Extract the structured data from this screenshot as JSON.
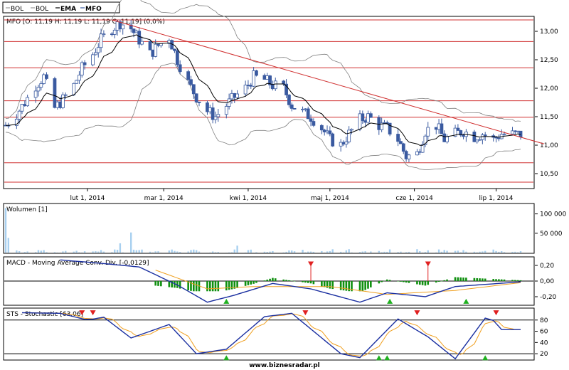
{
  "legend": {
    "items": [
      {
        "label": "BOL",
        "bold": false
      },
      {
        "label": "BOL",
        "bold": false
      },
      {
        "label": "EMA",
        "bold": true
      },
      {
        "label": "MFO",
        "bold": true
      }
    ]
  },
  "price_panel": {
    "info": "MFO [O: 11,19  H: 11,19  L: 11,19  C: 11,19] (0,0%)",
    "yticks": [
      "13,00",
      "12,50",
      "12,00",
      "11,50",
      "11,00",
      "10,50"
    ],
    "xticks": [
      "lut 1, 2014",
      "mar 1, 2014",
      "kwi 1, 2014",
      "maj 1, 2014",
      "cze 1, 2014",
      "lip 1, 2014"
    ]
  },
  "volume_panel": {
    "title": "Wolumen [1]",
    "yticks": [
      "100 000",
      "50 000"
    ]
  },
  "macd_panel": {
    "title": "MACD - Moving Average Conv. Div. [-0,0129]",
    "yticks": [
      "0,20",
      "0,00",
      "-0,20"
    ]
  },
  "sts_panel": {
    "title": "STS - Stochastic [63,06]",
    "yticks": [
      "80",
      "60",
      "40",
      "20"
    ]
  },
  "footer": {
    "source": "www.biznesradar.pl"
  },
  "colors": {
    "candle": "#3a5aa0",
    "ema": "#000000",
    "bands": "#808080",
    "support": "#d03030",
    "trend": "#d03030",
    "volume": "#a8d0f0",
    "macd_line": "#1a2fa0",
    "signal_line": "#f0a020",
    "histogram": "#109010",
    "sell_marker": "#e02020",
    "buy_marker": "#20b020"
  },
  "chart_data": [
    {
      "type": "candlestick",
      "title": "MFO [O: 11,19  H: 11,19  L: 11,19  C: 11,19] (0,0%)",
      "xlabel": "",
      "ylabel": "",
      "x_range": [
        "2014-01-02",
        "2014-07-10"
      ],
      "x_ticks": [
        "lut 1, 2014",
        "mar 1, 2014",
        "kwi 1, 2014",
        "maj 1, 2014",
        "cze 1, 2014",
        "lip 1, 2014"
      ],
      "ylim": [
        10.25,
        13.25
      ],
      "support_resistance_levels": [
        13.2,
        12.82,
        12.36,
        11.78,
        11.49,
        10.69,
        10.35
      ],
      "trendline": [
        {
          "date": "2014-02-10",
          "price": 13.2
        },
        {
          "date": "2014-07-10",
          "price": 11.14
        }
      ],
      "close_path": [
        {
          "date": "2014-01-02",
          "price": 11.35
        },
        {
          "date": "2014-01-06",
          "price": 11.55
        },
        {
          "date": "2014-01-09",
          "price": 11.75
        },
        {
          "date": "2014-01-13",
          "price": 12.05
        },
        {
          "date": "2014-01-16",
          "price": 12.2
        },
        {
          "date": "2014-01-20",
          "price": 11.65
        },
        {
          "date": "2014-01-23",
          "price": 11.8
        },
        {
          "date": "2014-01-27",
          "price": 12.05
        },
        {
          "date": "2014-01-30",
          "price": 12.35
        },
        {
          "date": "2014-02-03",
          "price": 12.6
        },
        {
          "date": "2014-02-06",
          "price": 12.85
        },
        {
          "date": "2014-02-10",
          "price": 13.05
        },
        {
          "date": "2014-02-13",
          "price": 13.15
        },
        {
          "date": "2014-02-17",
          "price": 13.05
        },
        {
          "date": "2014-02-20",
          "price": 12.85
        },
        {
          "date": "2014-02-24",
          "price": 12.6
        },
        {
          "date": "2014-02-27",
          "price": 12.75
        },
        {
          "date": "2014-03-03",
          "price": 12.9
        },
        {
          "date": "2014-03-06",
          "price": 12.5
        },
        {
          "date": "2014-03-10",
          "price": 12.1
        },
        {
          "date": "2014-03-13",
          "price": 11.85
        },
        {
          "date": "2014-03-17",
          "price": 11.6
        },
        {
          "date": "2014-03-20",
          "price": 11.5
        },
        {
          "date": "2014-03-24",
          "price": 11.7
        },
        {
          "date": "2014-03-27",
          "price": 11.85
        },
        {
          "date": "2014-03-31",
          "price": 12.0
        },
        {
          "date": "2014-04-03",
          "price": 12.2
        },
        {
          "date": "2014-04-07",
          "price": 12.15
        },
        {
          "date": "2014-04-10",
          "price": 12.05
        },
        {
          "date": "2014-04-14",
          "price": 12.0
        },
        {
          "date": "2014-04-17",
          "price": 11.7
        },
        {
          "date": "2014-04-22",
          "price": 11.55
        },
        {
          "date": "2014-04-24",
          "price": 11.5
        },
        {
          "date": "2014-04-28",
          "price": 11.3
        },
        {
          "date": "2014-05-01",
          "price": 11.1
        },
        {
          "date": "2014-05-05",
          "price": 11.0
        },
        {
          "date": "2014-05-08",
          "price": 11.2
        },
        {
          "date": "2014-05-12",
          "price": 11.45
        },
        {
          "date": "2014-05-15",
          "price": 11.5
        },
        {
          "date": "2014-05-19",
          "price": 11.35
        },
        {
          "date": "2014-05-22",
          "price": 11.3
        },
        {
          "date": "2014-05-26",
          "price": 11.1
        },
        {
          "date": "2014-05-29",
          "price": 10.8
        },
        {
          "date": "2014-06-02",
          "price": 10.85
        },
        {
          "date": "2014-06-05",
          "price": 11.25
        },
        {
          "date": "2014-06-09",
          "price": 11.35
        },
        {
          "date": "2014-06-12",
          "price": 11.1
        },
        {
          "date": "2014-06-16",
          "price": 11.2
        },
        {
          "date": "2014-06-19",
          "price": 11.25
        },
        {
          "date": "2014-06-23",
          "price": 11.15
        },
        {
          "date": "2014-06-26",
          "price": 11.2
        },
        {
          "date": "2014-06-30",
          "price": 11.1
        },
        {
          "date": "2014-07-03",
          "price": 11.2
        },
        {
          "date": "2014-07-07",
          "price": 11.19
        },
        {
          "date": "2014-07-10",
          "price": 11.19
        }
      ]
    },
    {
      "type": "bar",
      "title": "Wolumen [1]",
      "ylim": [
        0,
        125000
      ],
      "y_ticks": [
        100000,
        50000
      ],
      "notable_values": [
        {
          "date": "2014-01-02",
          "value": 115000
        },
        {
          "date": "2014-01-03",
          "value": 38000
        },
        {
          "date": "2014-02-17",
          "value": 52000
        },
        {
          "date": "2014-02-13",
          "value": 24000
        },
        {
          "date": "2014-03-28",
          "value": 18000
        }
      ]
    },
    {
      "type": "line",
      "title": "MACD - Moving Average Conv. Div. [-0,0129]",
      "ylim": [
        -0.3,
        0.3
      ],
      "y_ticks": [
        0.2,
        0.0,
        -0.2
      ],
      "series": [
        {
          "values_by_date": [
            {
              "date": "2014-01-22",
              "value": 0.27
            },
            {
              "date": "2014-02-05",
              "value": 0.23
            },
            {
              "date": "2014-02-20",
              "value": 0.18
            },
            {
              "date": "2014-03-06",
              "value": -0.05
            },
            {
              "date": "2014-03-17",
              "value": -0.27
            },
            {
              "date": "2014-03-27",
              "value": -0.18
            },
            {
              "date": "2014-04-10",
              "value": -0.03
            },
            {
              "date": "2014-04-24",
              "value": -0.1
            },
            {
              "date": "2014-05-12",
              "value": -0.27
            },
            {
              "date": "2014-05-22",
              "value": -0.15
            },
            {
              "date": "2014-06-05",
              "value": -0.2
            },
            {
              "date": "2014-06-16",
              "value": -0.07
            },
            {
              "date": "2014-07-10",
              "value": -0.01
            }
          ]
        },
        {
          "values_by_date": [
            {
              "date": "2014-02-26",
              "value": 0.14
            },
            {
              "date": "2014-03-17",
              "value": -0.1
            },
            {
              "date": "2014-04-03",
              "value": -0.07
            },
            {
              "date": "2014-05-01",
              "value": -0.07
            },
            {
              "date": "2014-05-22",
              "value": -0.17
            },
            {
              "date": "2014-06-16",
              "value": -0.12
            },
            {
              "date": "2014-07-10",
              "value": -0.02
            }
          ]
        }
      ],
      "histogram_range": [
        -0.13,
        0.06
      ],
      "sell_signals": [
        "2014-04-24",
        "2014-06-06"
      ],
      "buy_signals": [
        "2014-03-24",
        "2014-05-23",
        "2014-06-20"
      ]
    },
    {
      "type": "line",
      "title": "STS - Stochastic [63,06]",
      "ylim": [
        10,
        100
      ],
      "y_ticks": [
        80,
        60,
        40,
        20
      ],
      "reference_levels": [
        80,
        20
      ],
      "series": [
        {
          "values_by_date": [
            {
              "date": "2014-01-08",
              "value": 93
            },
            {
              "date": "2014-01-22",
              "value": 92
            },
            {
              "date": "2014-02-01",
              "value": 80
            },
            {
              "date": "2014-02-07",
              "value": 85
            },
            {
              "date": "2014-02-17",
              "value": 48
            },
            {
              "date": "2014-03-03",
              "value": 72
            },
            {
              "date": "2014-03-13",
              "value": 20
            },
            {
              "date": "2014-03-24",
              "value": 28
            },
            {
              "date": "2014-04-07",
              "value": 86
            },
            {
              "date": "2014-04-17",
              "value": 92
            },
            {
              "date": "2014-05-05",
              "value": 20
            },
            {
              "date": "2014-05-12",
              "value": 13
            },
            {
              "date": "2014-05-26",
              "value": 82
            },
            {
              "date": "2014-06-06",
              "value": 50
            },
            {
              "date": "2014-06-16",
              "value": 11
            },
            {
              "date": "2014-06-28",
              "value": 90
            },
            {
              "date": "2014-07-03",
              "value": 63
            },
            {
              "date": "2014-07-10",
              "value": 63
            }
          ]
        }
      ],
      "sell_signals": [
        "2014-01-30",
        "2014-02-03",
        "2014-04-22",
        "2014-06-02",
        "2014-07-01"
      ],
      "buy_signals": [
        "2014-03-24",
        "2014-05-19",
        "2014-05-22",
        "2014-06-27"
      ]
    }
  ]
}
